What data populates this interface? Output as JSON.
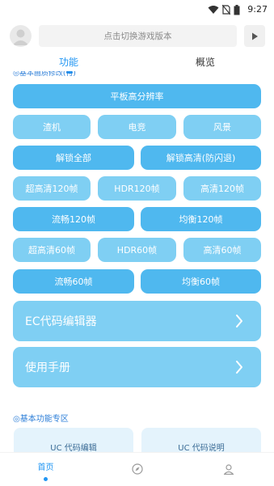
{
  "status_bar": {
    "time": "9:27"
  },
  "top_bar": {
    "search_label": "点击切换游戏版本"
  },
  "tabs": [
    {
      "label": "功能",
      "active": true
    },
    {
      "label": "概览",
      "active": false
    }
  ],
  "partial_heading": "◎基本画质修改(付)",
  "feature_buttons": [
    {
      "label": "平板高分辨率",
      "style": "dark"
    },
    {
      "label": "渣机",
      "style": "light"
    },
    {
      "label": "电竞",
      "style": "light"
    },
    {
      "label": "风景",
      "style": "light"
    },
    {
      "label": "解锁全部",
      "style": "dark"
    },
    {
      "label": "解锁高清(防闪退)",
      "style": "dark"
    },
    {
      "label": "超高清120帧",
      "style": "light"
    },
    {
      "label": "HDR120帧",
      "style": "light"
    },
    {
      "label": "高清120帧",
      "style": "light"
    },
    {
      "label": "流畅120帧",
      "style": "dark"
    },
    {
      "label": "均衡120帧",
      "style": "dark"
    },
    {
      "label": "超高清60帧",
      "style": "light"
    },
    {
      "label": "HDR60帧",
      "style": "light"
    },
    {
      "label": "高清60帧",
      "style": "light"
    },
    {
      "label": "流畅60帧",
      "style": "dark"
    },
    {
      "label": "均衡60帧",
      "style": "dark"
    }
  ],
  "nav_rows": [
    {
      "label": "EC代码编辑器"
    },
    {
      "label": "使用手册"
    }
  ],
  "basic_section": {
    "title": "◎基本功能专区",
    "cards": [
      {
        "label": "UC 代码编辑"
      },
      {
        "label": "UC 代码说明"
      }
    ]
  },
  "bottom_nav": [
    {
      "label": "首页",
      "icon": "home-icon",
      "active": true
    },
    {
      "label": "",
      "icon": "compass-icon",
      "active": false
    },
    {
      "label": "",
      "icon": "user-icon",
      "active": false
    }
  ],
  "colors": {
    "accent": "#2196f3",
    "button_dark": "#4fb8ef",
    "button_light": "#7fcff3",
    "card_bg": "#e4f3fc"
  }
}
